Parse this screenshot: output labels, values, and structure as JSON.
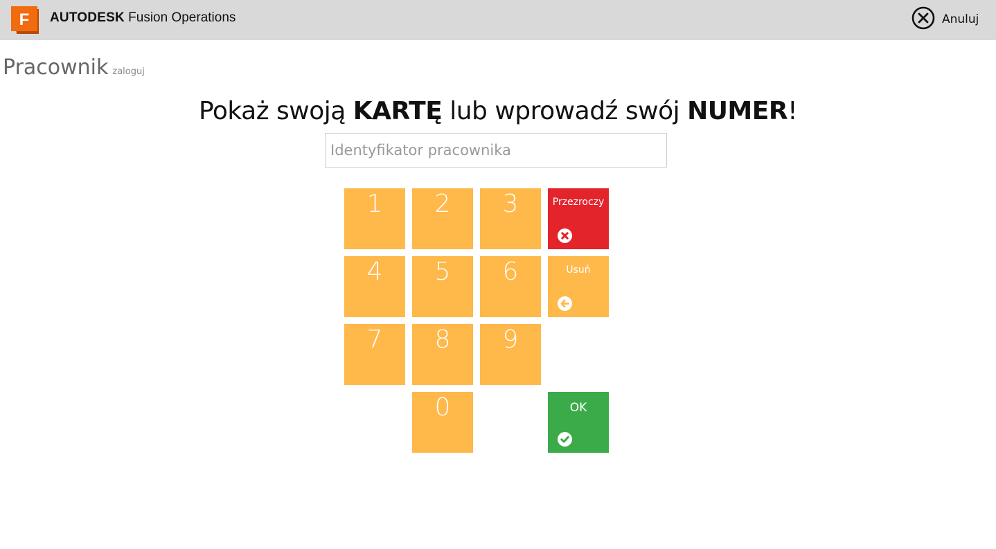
{
  "header": {
    "brand_bold": "AUTODESK",
    "brand_rest": "Fusion Operations",
    "logo_letter": "F",
    "cancel_label": "Anuluj"
  },
  "page": {
    "title": "Pracownik",
    "subtitle": "zaloguj"
  },
  "prompt": {
    "part1": "Pokaż swoją ",
    "card": "KARTĘ",
    "part2": " lub wprowadź swój ",
    "number": "NUMER",
    "part3": "!"
  },
  "input": {
    "placeholder": "Identyfikator pracownika",
    "value": ""
  },
  "keypad": {
    "digits": [
      "1",
      "2",
      "3",
      "4",
      "5",
      "6",
      "7",
      "8",
      "9",
      "0"
    ],
    "clear_label": "Przezroczy",
    "delete_label": "Usuń",
    "ok_label": "OK"
  },
  "colors": {
    "topbar": "#d9d9d9",
    "digit_key": "#ffb84a",
    "clear_key": "#e3242b",
    "ok_key": "#3bab4a",
    "logo_orange": "#f26b0f"
  },
  "icons": {
    "logo": "fusion-logo-icon",
    "cancel": "close-circle-icon",
    "clear": "x-circle-icon",
    "delete": "arrow-left-circle-icon",
    "ok": "check-circle-icon"
  }
}
